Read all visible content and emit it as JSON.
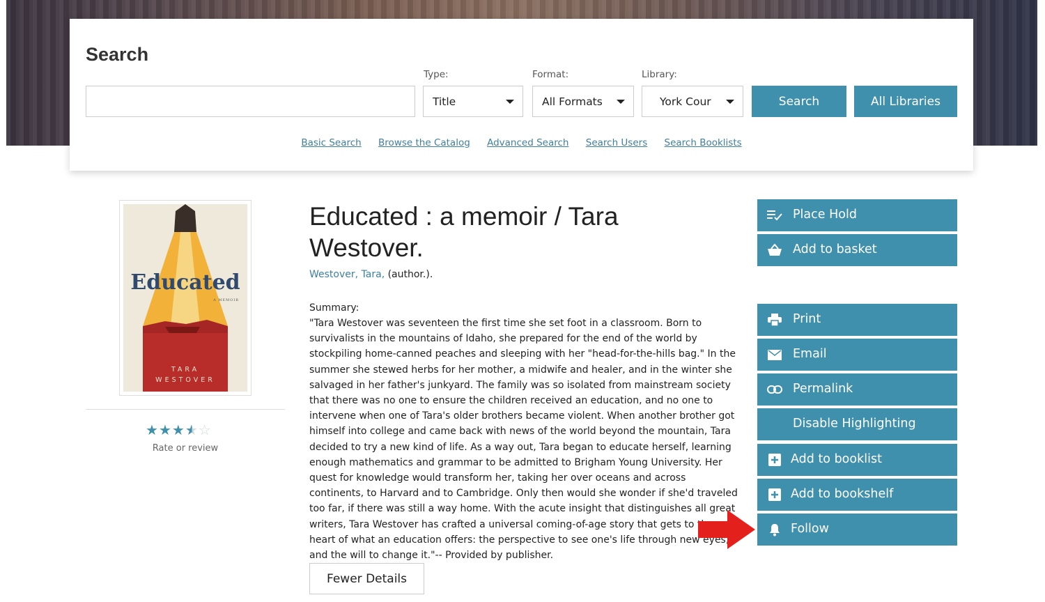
{
  "search": {
    "title": "Search",
    "input_value": "",
    "type_label": "Type:",
    "type_value": "Title",
    "format_label": "Format:",
    "format_value": "All Formats",
    "library_label": "Library:",
    "library_value": "York Cour",
    "search_button": "Search",
    "all_libraries_button": "All Libraries"
  },
  "search_links": [
    "Basic Search",
    "Browse the Catalog",
    "Advanced Search",
    "Search Users",
    "Search Booklists"
  ],
  "book": {
    "title": "Educated : a memoir / Tara Westover.",
    "author_link": "Westover, Tara,",
    "author_role": " (author.).",
    "summary_label": "Summary:",
    "summary": "\"Tara Westover was seventeen the first time she set foot in a classroom. Born to survivalists in the mountains of Idaho, she prepared for the end of the world by stockpiling home-canned peaches and sleeping with her \"head-for-the-hills bag.\" In the summer she stewed herbs for her mother, a midwife and healer, and in the winter she salvaged in her father's junkyard. The family was so isolated from mainstream society that there was no one to ensure the children received an education, and no one to intervene when one of Tara's older brothers became violent. When another brother got himself into college and came back with news of the world beyond the mountain, Tara decided to try a new kind of life. As a way out, Tara began to educate herself, learning enough mathematics and grammar to be admitted to Brigham Young University. Her quest for knowledge would transform her, taking her over oceans and across continents, to Harvard and to Cambridge. Only then would she wonder if she'd traveled too far, if there was still a way home. With the acute insight that distinguishes all great writers, Tara Westover has crafted a universal coming-of-age story that gets to the heart of what an education offers: the perspective to see one's life through new eyes, and the will to change it.\"-- Provided by publisher.",
    "fewer_details": "Fewer Details",
    "cover_title": "Educated",
    "cover_subtitle": "A MEMOIR",
    "cover_author_first": "TARA",
    "cover_author_last": "WESTOVER",
    "rating": {
      "filled": 3.5,
      "max": 5
    },
    "rate_label": "Rate or review"
  },
  "actions": {
    "place_hold": {
      "label": "Place Hold",
      "icon": "list-check-icon"
    },
    "add_to_basket": {
      "label": "Add to basket",
      "icon": "basket-icon"
    },
    "print": {
      "label": "Print",
      "icon": "printer-icon"
    },
    "email": {
      "label": "Email",
      "icon": "envelope-icon"
    },
    "permalink": {
      "label": "Permalink",
      "icon": "link-icon"
    },
    "disable_highlighting": {
      "label": "Disable Highlighting"
    },
    "add_to_booklist": {
      "label": "Add to booklist",
      "icon": "plus-square-icon"
    },
    "add_to_bookshelf": {
      "label": "Add to bookshelf",
      "icon": "plus-square-icon"
    },
    "follow": {
      "label": "Follow",
      "icon": "bell-icon"
    }
  },
  "colors": {
    "accent": "#3f90ad",
    "link": "#3f7f9e",
    "arrow": "#e3201b"
  }
}
